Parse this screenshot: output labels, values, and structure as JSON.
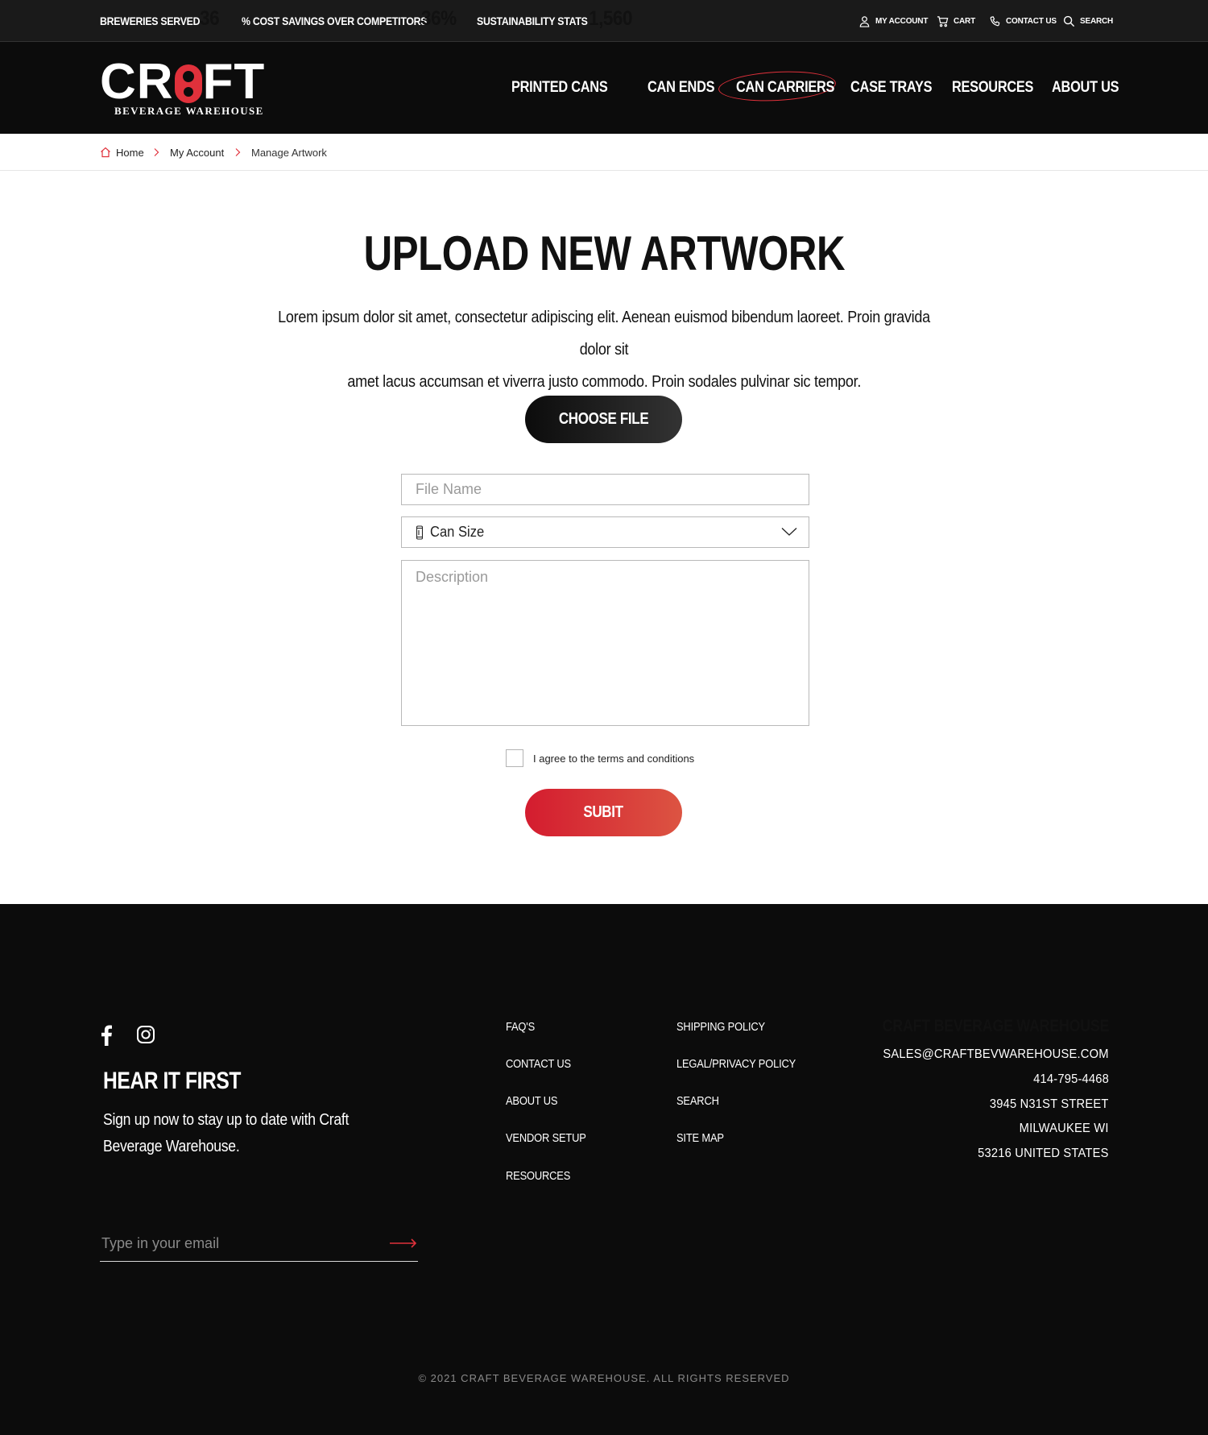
{
  "topbar": {
    "stats": [
      {
        "label": "BREWERIES SERVED",
        "value": "36"
      },
      {
        "label": "% COST SAVINGS OVER COMPETITORS",
        "value": "36%"
      },
      {
        "label": "SUSTAINABILITY STATS",
        "value": "1,560"
      }
    ],
    "utility": {
      "account": "MY ACCOUNT",
      "cart": "CART",
      "contact": "CONTACT US",
      "search": "SEARCH"
    }
  },
  "brand": {
    "word_left": "CR",
    "word_right": "FT",
    "subtitle": "BEVERAGE WAREHOUSE",
    "accent_color": "#e0313b"
  },
  "nav": {
    "items": [
      "PRINTED CANS",
      "CAN ENDS",
      "CAN CARRIERS",
      "CASE TRAYS",
      "RESOURCES",
      "ABOUT US"
    ],
    "active_index": 2
  },
  "breadcrumb": {
    "home": "Home",
    "account": "My Account",
    "current": "Manage Artwork"
  },
  "main": {
    "title": "UPLOAD NEW ARTWORK",
    "intro_line1": "Lorem ipsum dolor sit amet, consectetur adipiscing elit. Aenean euismod bibendum laoreet. Proin gravida dolor sit",
    "intro_line2": "amet lacus accumsan et viverra justo commodo. Proin sodales pulvinar sic tempor.",
    "choose_file_label": "CHOOSE FILE",
    "file_name_placeholder": "File Name",
    "can_size_selected": "Can Size",
    "description_placeholder": "Description",
    "agree_label": "I agree to the terms and conditions",
    "submit_label": "SUBIT"
  },
  "footer": {
    "heading": "HEAR IT FIRST",
    "signup_text": "Sign up now to stay up to date with Craft Beverage Warehouse.",
    "email_placeholder": "Type in your email",
    "links_col1": [
      "FAQ'S",
      "CONTACT US",
      "ABOUT US",
      "VENDOR SETUP",
      "RESOURCES"
    ],
    "links_col2": [
      "SHIPPING POLICY",
      "LEGAL/PRIVACY POLICY",
      "SEARCH",
      "SITE MAP"
    ],
    "company": {
      "name": "CRAFT BEVERAGE WAREHOUSE",
      "email": "SALES@CRAFTBEVWAREHOUSE.COM",
      "phone": "414-795-4468",
      "street": "3945 N31ST STREET",
      "city": "MILWAUKEE WI",
      "zip_country": "53216 UNITED STATES"
    },
    "copyright": "© 2021 CRAFT BEVERAGE WAREHOUSE. ALL RIGHTS RESERVED"
  }
}
